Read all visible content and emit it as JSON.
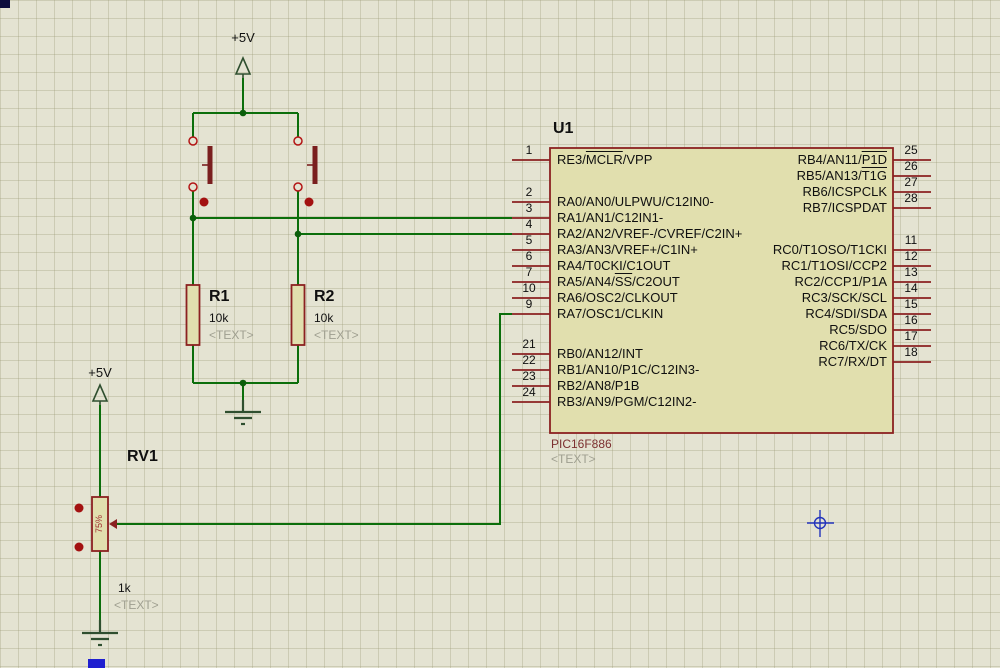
{
  "schematic": {
    "chip": {
      "ref": "U1",
      "part": "PIC16F886",
      "placeholder": "<TEXT>",
      "left_pins": [
        {
          "num": "1",
          "segments": [
            {
              "t": "RE3/"
            },
            {
              "t": "MCLR",
              "ol": true
            },
            {
              "t": "/VPP"
            }
          ]
        },
        {
          "num": "2",
          "segments": [
            {
              "t": "RA0/AN0/ULPWU/C12IN0-"
            }
          ]
        },
        {
          "num": "3",
          "segments": [
            {
              "t": "RA1/AN1/C12IN1-"
            }
          ]
        },
        {
          "num": "4",
          "segments": [
            {
              "t": "RA2/AN2/VREF-/CVREF/C2IN+"
            }
          ]
        },
        {
          "num": "5",
          "segments": [
            {
              "t": "RA3/AN3/VREF+/C1IN+"
            }
          ]
        },
        {
          "num": "6",
          "segments": [
            {
              "t": "RA4/T0CKI/C1OUT"
            }
          ]
        },
        {
          "num": "7",
          "segments": [
            {
              "t": "RA5/AN4/"
            },
            {
              "t": "SS",
              "ol": true
            },
            {
              "t": "/C2OUT"
            }
          ]
        },
        {
          "num": "10",
          "segments": [
            {
              "t": "RA6/OSC2/CLKOUT"
            }
          ]
        },
        {
          "num": "9",
          "segments": [
            {
              "t": "RA7/OSC1/CLKIN"
            }
          ]
        },
        {
          "num": "21",
          "segments": [
            {
              "t": "RB0/AN12/INT"
            }
          ]
        },
        {
          "num": "22",
          "segments": [
            {
              "t": "RB1/AN10/P1C/C12IN3-"
            }
          ]
        },
        {
          "num": "23",
          "segments": [
            {
              "t": "RB2/AN8/P1B"
            }
          ]
        },
        {
          "num": "24",
          "segments": [
            {
              "t": "RB3/AN9/PGM/C12IN2-"
            }
          ]
        }
      ],
      "right_pins": [
        {
          "num": "25",
          "segments": [
            {
              "t": "RB4/AN11/"
            },
            {
              "t": "P1D",
              "ol": true
            }
          ]
        },
        {
          "num": "26",
          "segments": [
            {
              "t": "RB5/AN13/"
            },
            {
              "t": "T1G",
              "ol": true
            }
          ]
        },
        {
          "num": "27",
          "segments": [
            {
              "t": "RB6/ICSPCLK"
            }
          ]
        },
        {
          "num": "28",
          "segments": [
            {
              "t": "RB7/ICSPDAT"
            }
          ]
        },
        {
          "num": "11",
          "segments": [
            {
              "t": "RC0/T1OSO/T1CKI"
            }
          ]
        },
        {
          "num": "12",
          "segments": [
            {
              "t": "RC1/T1OSI/CCP2"
            }
          ]
        },
        {
          "num": "13",
          "segments": [
            {
              "t": "RC2/CCP1/P1A"
            }
          ]
        },
        {
          "num": "14",
          "segments": [
            {
              "t": "RC3/SCK/SCL"
            }
          ]
        },
        {
          "num": "15",
          "segments": [
            {
              "t": "RC4/SDI/SDA"
            }
          ]
        },
        {
          "num": "16",
          "segments": [
            {
              "t": "RC5/SDO"
            }
          ]
        },
        {
          "num": "17",
          "segments": [
            {
              "t": "RC6/TX/CK"
            }
          ]
        },
        {
          "num": "18",
          "segments": [
            {
              "t": "RC7/RX/DT"
            }
          ]
        }
      ]
    },
    "resistors": [
      {
        "ref": "R1",
        "value": "10k",
        "placeholder": "<TEXT>"
      },
      {
        "ref": "R2",
        "value": "10k",
        "placeholder": "<TEXT>"
      }
    ],
    "pot": {
      "ref": "RV1",
      "value": "1k",
      "placeholder": "<TEXT>",
      "wiper_pct": "75%"
    },
    "power_labels": {
      "top": "+5V",
      "left": "+5V"
    },
    "colors": {
      "background": "#e4e3d2",
      "wire_green": "#0b6e0b",
      "component_maroon": "#8b2121",
      "component_fill": "#e1dfae",
      "placeholder_gray": "#9f9f90",
      "part_text_red": "#7c3030",
      "marker_blue": "#2233bb",
      "button_red": "#a31111"
    }
  }
}
